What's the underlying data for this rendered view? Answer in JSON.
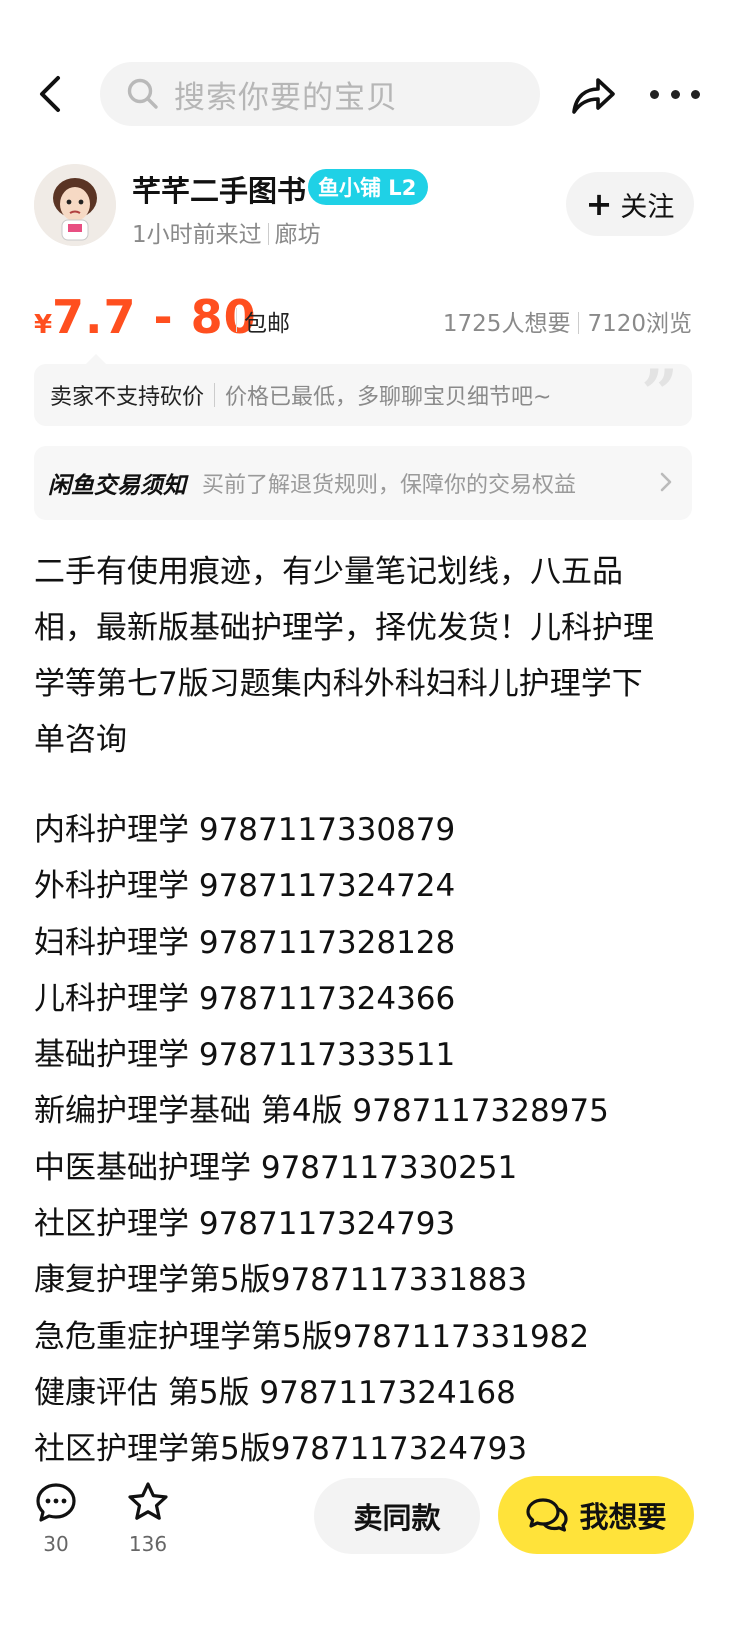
{
  "topbar": {
    "back_icon": "chevron-left-icon",
    "search_placeholder": "搜索你要的宝贝",
    "share_icon": "share-icon",
    "more_icon": "more-dots-icon"
  },
  "seller": {
    "name": "芊芊二手图书",
    "badge": "鱼小铺 L2",
    "last_seen": "1小时前来过",
    "location": "廊坊",
    "follow_label": "关注"
  },
  "price": {
    "currency": "¥",
    "range": "7.7 - 80",
    "shipping": "包邮",
    "wants": "1725人想要",
    "views": "7120浏览",
    "accent_color": "#ff4f1f"
  },
  "bargain": {
    "main": "卖家不支持砍价",
    "sub": "价格已最低，多聊聊宝贝细节吧~"
  },
  "notice": {
    "title": "闲鱼交易须知",
    "desc": "买前了解退货规则，保障你的交易权益"
  },
  "description": {
    "lines": [
      "二手有使用痕迹，有少量笔记划线，八五品",
      "相，最新版基础护理学，择优发货！儿科护理",
      "学等第七7版习题集内科外科妇科儿护理学下",
      "单咨询"
    ],
    "books": [
      "内科护理学 9787117330879",
      "外科护理学 9787117324724",
      "妇科护理学 9787117328128",
      "儿科护理学 9787117324366",
      "基础护理学 9787117333511",
      "新编护理学基础 第4版 9787117328975",
      "中医基础护理学 9787117330251",
      "社区护理学 9787117324793",
      "康复护理学第5版9787117331883",
      "急危重症护理学第5版9787117331982",
      "健康评估 第5版 9787117324168",
      "社区护理学第5版9787117324793"
    ]
  },
  "bottom": {
    "comments_count": "30",
    "favorites_count": "136",
    "sell_same_label": "卖同款",
    "want_label": "我想要",
    "want_color": "#ffe33a"
  }
}
